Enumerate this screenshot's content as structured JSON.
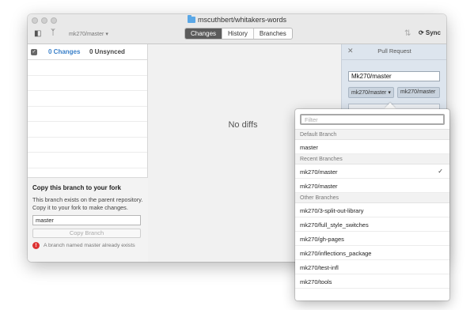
{
  "window": {
    "repo_title": "mscuthbert/whitakers-words",
    "branch_selector": "mk270/master",
    "tabs": [
      "Changes",
      "History",
      "Branches"
    ],
    "active_tab": "Changes",
    "sync_label": "Sync"
  },
  "changes_panel": {
    "changes_tab": "0 Changes",
    "unsynced_tab": "0 Unsynced"
  },
  "fork_panel": {
    "title": "Copy this branch to your fork",
    "description": "This branch exists on the parent repository. Copy it to your fork to make changes.",
    "branch_input_value": "master",
    "copy_button": "Copy Branch",
    "error_message": "A branch named master already exists"
  },
  "diff_view": {
    "empty_message": "No diffs"
  },
  "pull_request": {
    "title": "Pull Request",
    "title_input_value": "Mk270/master",
    "base_branch": "mk270/master",
    "compare_branch": "mk270/master"
  },
  "branch_dropdown": {
    "filter_placeholder": "Filter",
    "sections": [
      {
        "header": "Default Branch",
        "items": [
          "master"
        ]
      },
      {
        "header": "Recent Branches",
        "items": [
          "mk270/master",
          "mk270/master"
        ]
      },
      {
        "header": "Other Branches",
        "items": [
          "mk270/3-split-out-library",
          "mk270/full_style_switches",
          "mk270/gh-pages",
          "mk270/inflections_package",
          "mk270/test-infl",
          "mk270/tools"
        ]
      }
    ],
    "checked_item": "mk270/master"
  },
  "colors": {
    "accent": "#3a80c9",
    "error": "#dd3333",
    "pr_panel_bg": "#dde5ee"
  }
}
